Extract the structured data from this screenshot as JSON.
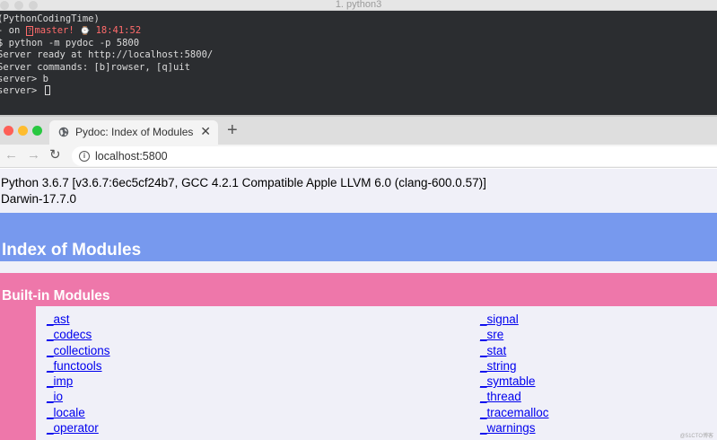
{
  "terminal": {
    "window_title": "1. python3",
    "lines": {
      "l1": "(PythonCodingTime)",
      "l2_prefix": "- on ",
      "l2_branch_icon": "?",
      "l2_branch": "master!",
      "l2_clock_icon": "⌚",
      "l2_time": "18:41:52",
      "l3": "$ python -m pydoc -p 5800",
      "l4": "Server ready at http://localhost:5800/",
      "l5": "Server commands: [b]rowser, [q]uit",
      "l6": "server> b",
      "l7": "server> "
    },
    "accent_color": "#ff6b6b",
    "background_color": "#2b2d30"
  },
  "browser": {
    "tab": {
      "title": "Pydoc: Index of Modules",
      "icon": "globe-icon",
      "close_glyph": "✕"
    },
    "new_tab_glyph": "+",
    "nav": {
      "back_glyph": "←",
      "forward_glyph": "→",
      "reload_glyph": "↻",
      "info_glyph": "i"
    },
    "url": "localhost:5800",
    "traffic_lights": [
      "#fe5f57",
      "#febc2e",
      "#28c840"
    ]
  },
  "page": {
    "version": "Python 3.6.7 [v3.6.7:6ec5cf24b7, GCC 4.2.1 Compatible Apple LLVM 6.0 (clang-600.0.57)]",
    "platform": "Darwin-17.7.0",
    "title": "Index of Modules",
    "section_title": "Built-in Modules",
    "heading_color": "#7799ee",
    "section_color": "#ee77aa",
    "modules_left": [
      "_ast",
      "_codecs",
      "_collections",
      "_functools",
      "_imp",
      "_io",
      "_locale",
      "_operator"
    ],
    "modules_right": [
      "_signal",
      "_sre",
      "_stat",
      "_string",
      "_symtable",
      "_thread",
      "_tracemalloc",
      "_warnings"
    ]
  },
  "watermark": "@51CTO博客"
}
